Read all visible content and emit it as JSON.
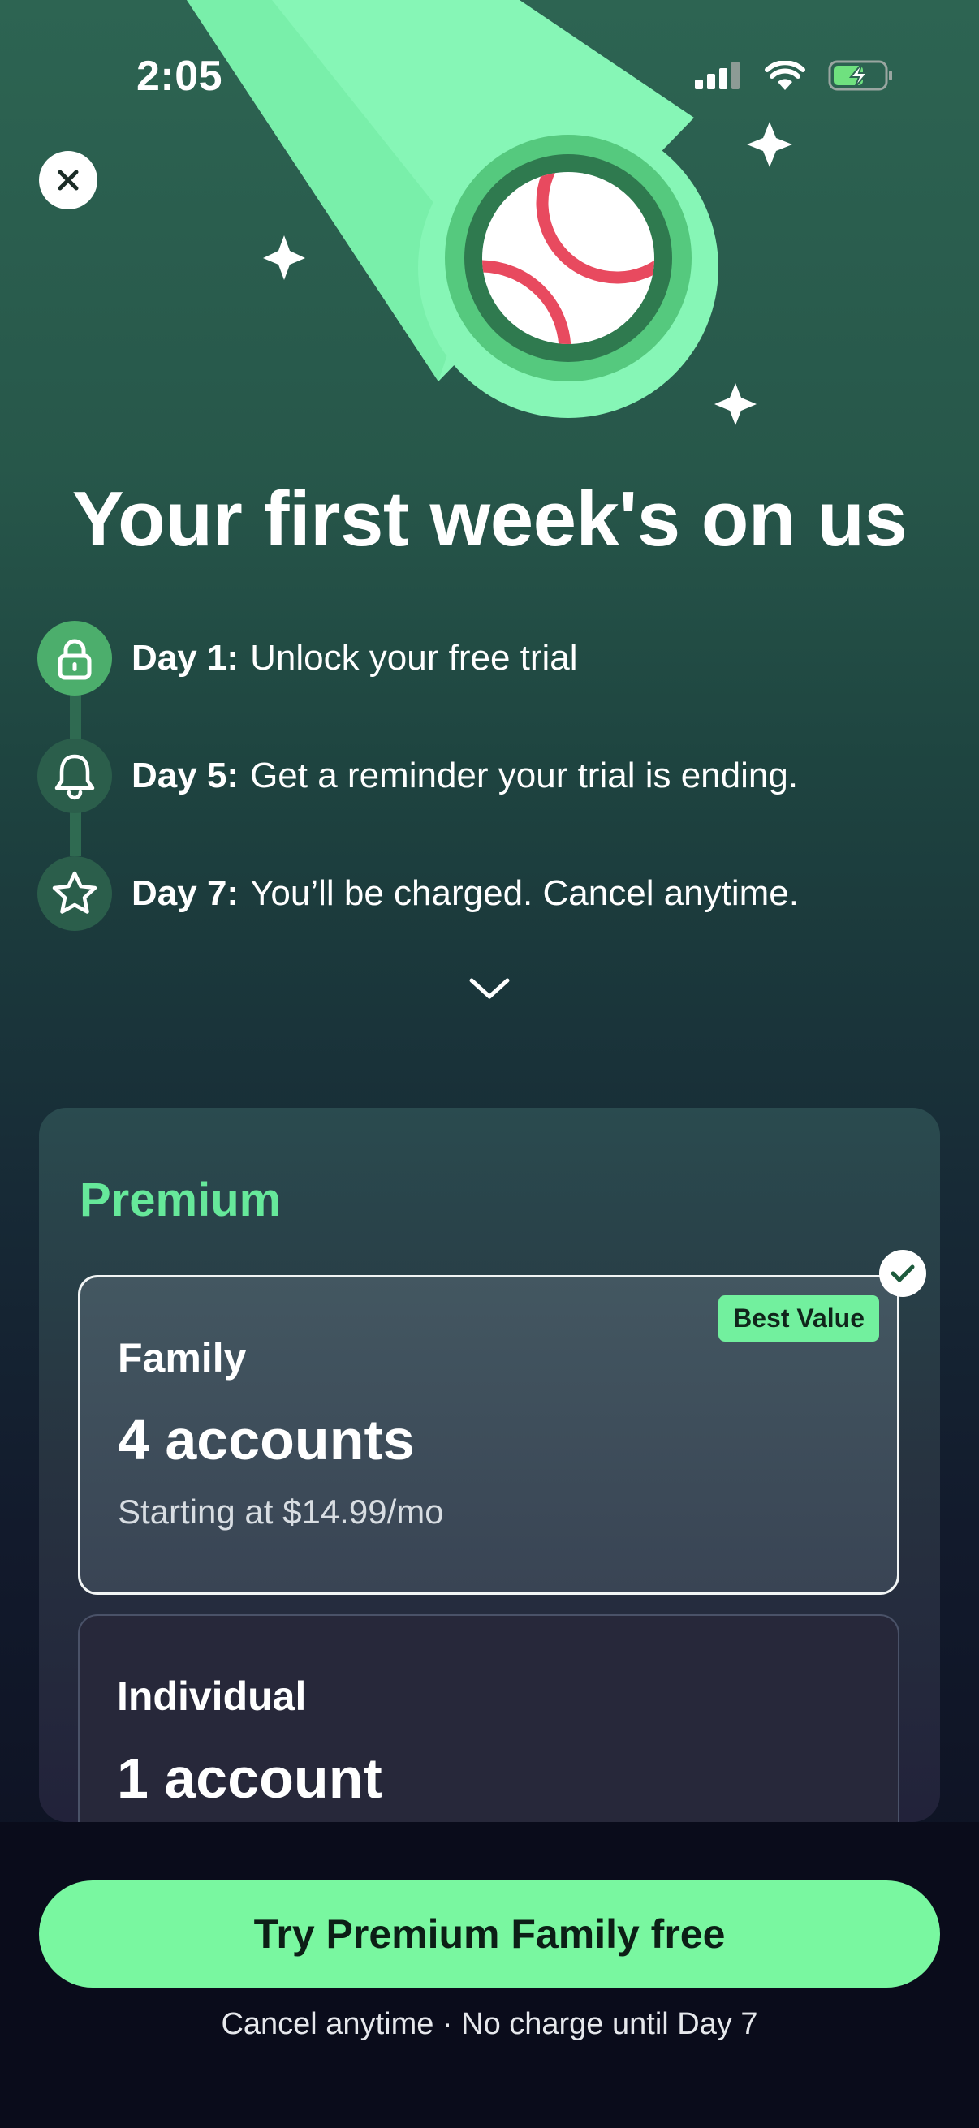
{
  "status_bar": {
    "time": "2:05"
  },
  "icons": {
    "close": "close-icon",
    "signal": "cellular-signal-icon",
    "wifi": "wifi-icon",
    "battery": "battery-charging-icon",
    "lock": "lock-icon",
    "bell": "bell-icon",
    "star": "star-icon",
    "chevron": "chevron-down-icon",
    "check": "checkmark-icon",
    "ball": "tennis-ball-icon",
    "sparkle": "sparkle-icon"
  },
  "colors": {
    "accent_green": "#79f7a0",
    "premium_label": "#66e89a",
    "tennis_ball_stripe": "#e84a5f"
  },
  "headline": "Your first week's on us",
  "timeline": [
    {
      "day": "Day 1:",
      "text": "Unlock your free trial",
      "state": "active"
    },
    {
      "day": "Day 5:",
      "text": "Get a reminder your trial is ending.",
      "state": "pending"
    },
    {
      "day": "Day 7:",
      "text": "You’ll be charged. Cancel anytime.",
      "state": "pending"
    }
  ],
  "plans": {
    "title": "Premium",
    "options": [
      {
        "name": "Family",
        "count": "4 accounts",
        "price": "Starting at $14.99/mo",
        "badge": "Best Value",
        "selected": true
      },
      {
        "name": "Individual",
        "count": "1 account",
        "selected": false
      }
    ]
  },
  "cta": {
    "label": "Try Premium Family free",
    "note": "Cancel anytime · No charge until Day 7"
  }
}
